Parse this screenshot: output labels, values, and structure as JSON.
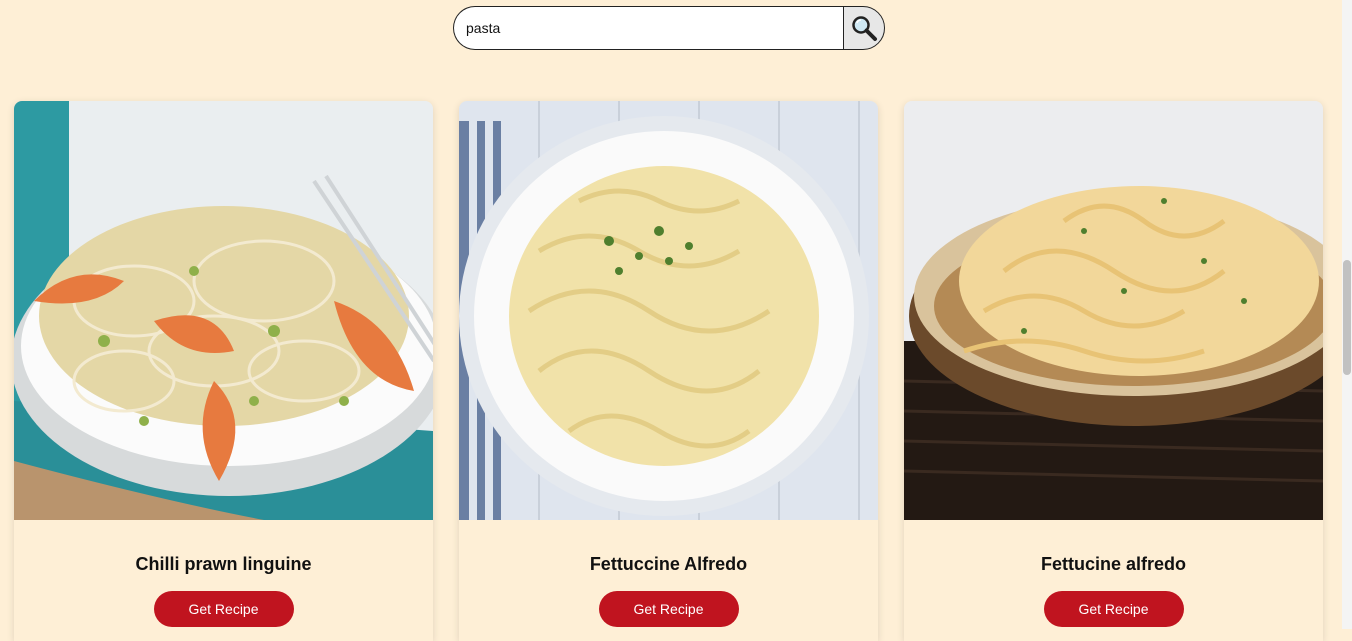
{
  "search": {
    "value": "pasta",
    "icon": "magnifying-glass-icon"
  },
  "colors": {
    "background": "#feefd6",
    "button": "#c0141f",
    "button_text": "#ffffff"
  },
  "recipes": [
    {
      "title": "Chilli prawn linguine",
      "button_label": "Get Recipe"
    },
    {
      "title": "Fettuccine Alfredo",
      "button_label": "Get Recipe"
    },
    {
      "title": "Fettucine alfredo",
      "button_label": "Get Recipe"
    }
  ]
}
